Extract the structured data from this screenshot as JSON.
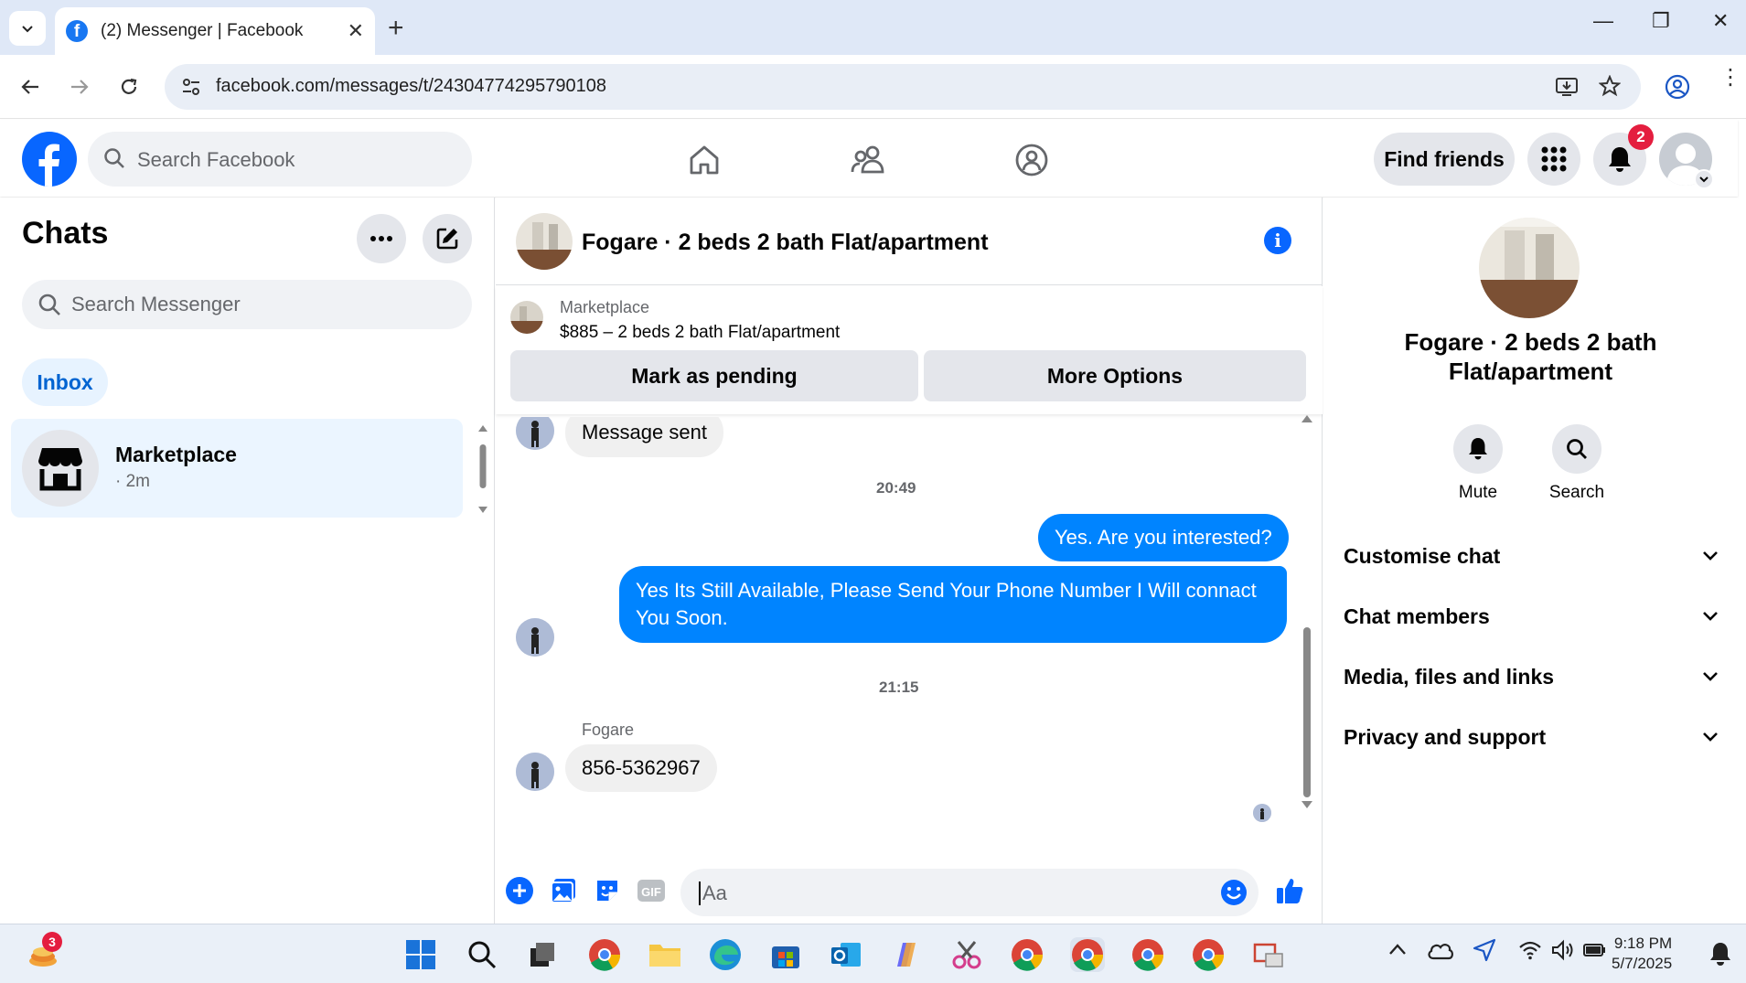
{
  "browser": {
    "tab_title": "(2) Messenger | Facebook",
    "url": "facebook.com/messages/t/24304774295790108"
  },
  "fb_header": {
    "search_placeholder": "Search Facebook",
    "find_friends": "Find friends",
    "notification_count": "2",
    "brand_color": "#0866ff"
  },
  "chats": {
    "title": "Chats",
    "search_placeholder": "Search Messenger",
    "inbox_label": "Inbox",
    "items": [
      {
        "name": "Marketplace",
        "time": "· 2m"
      }
    ]
  },
  "conversation": {
    "title": "Fogare · 2 beds 2 bath Flat/apartment",
    "marketplace_label": "Marketplace",
    "listing": "$885 – 2 beds 2 bath Flat/apartment",
    "mark_pending": "Mark as pending",
    "more_options": "More Options",
    "messages": [
      {
        "from": "them",
        "text": "Message sent"
      },
      {
        "stamp": "20:49"
      },
      {
        "from": "me",
        "text": "Yes. Are you interested?"
      },
      {
        "from": "me",
        "text": "Yes Its Still Available, Please Send Your Phone Number I Will connact You Soon."
      },
      {
        "stamp": "21:15"
      },
      {
        "sender": "Fogare",
        "from": "them",
        "text": "856-5362967"
      }
    ],
    "composer_placeholder": "Aa",
    "bubble_color": "#0084ff"
  },
  "details": {
    "name": "Fogare · 2 beds 2 bath Flat/apartment",
    "actions": [
      {
        "label": "Mute",
        "icon": "bell-icon"
      },
      {
        "label": "Search",
        "icon": "search-icon"
      }
    ],
    "sections": [
      "Customise chat",
      "Chat members",
      "Media, files and links",
      "Privacy and support"
    ]
  },
  "taskbar": {
    "widget_badge": "3",
    "time": "9:18 PM",
    "date": "5/7/2025"
  }
}
